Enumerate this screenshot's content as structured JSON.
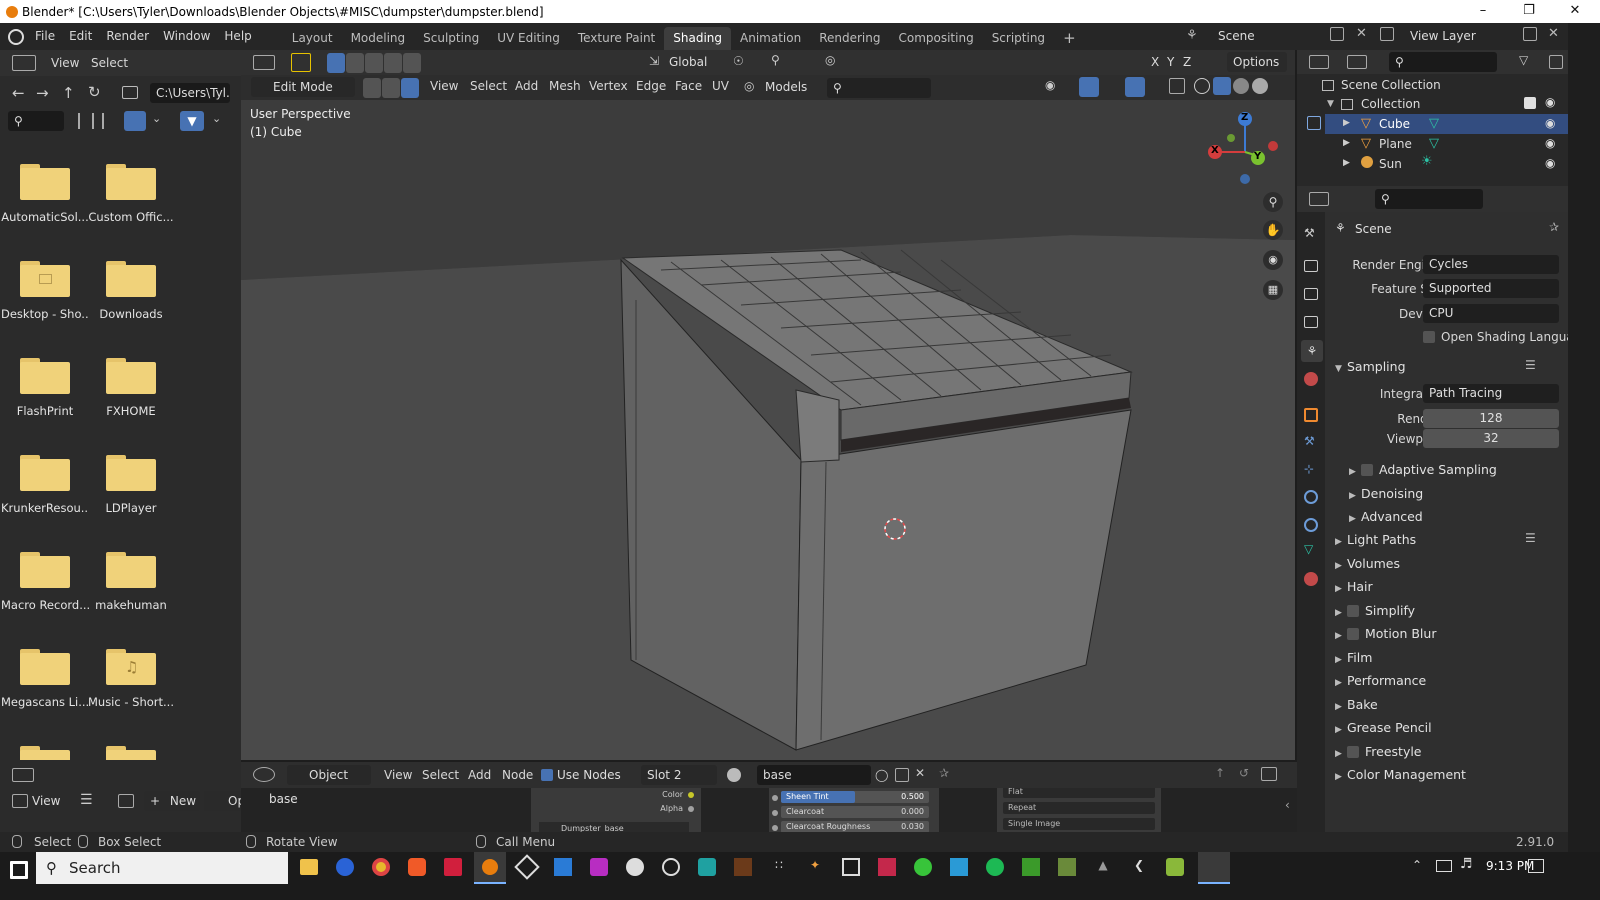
{
  "title_bar": {
    "title": "Blender* [C:\\Users\\Tyler\\Downloads\\Blender Objects\\#MISC\\dumpster\\dumpster.blend]"
  },
  "menu": {
    "items": [
      "File",
      "Edit",
      "Render",
      "Window",
      "Help"
    ]
  },
  "workspaces": {
    "tabs": [
      "Layout",
      "Modeling",
      "Sculpting",
      "UV Editing",
      "Texture Paint",
      "Shading",
      "Animation",
      "Rendering",
      "Compositing",
      "Scripting"
    ],
    "active": "Shading",
    "add": "+"
  },
  "scene_selector": {
    "scene": "Scene",
    "view_layer": "View Layer"
  },
  "file_browser": {
    "menu": [
      "View",
      "Select"
    ],
    "path": "C:\\Users\\Tyl...",
    "items": [
      {
        "name": "AutomaticSol...",
        "icon": "folder-icon"
      },
      {
        "name": "Custom Offic...",
        "icon": "folder-icon"
      },
      {
        "name": "Desktop - Sho...",
        "icon": "folder-shortcut-icon"
      },
      {
        "name": "Downloads",
        "icon": "folder-icon"
      },
      {
        "name": "FlashPrint",
        "icon": "folder-icon"
      },
      {
        "name": "FXHOME",
        "icon": "folder-icon"
      },
      {
        "name": "KrunkerResou...",
        "icon": "folder-icon"
      },
      {
        "name": "LDPlayer",
        "icon": "folder-icon"
      },
      {
        "name": "Macro Record...",
        "icon": "folder-icon"
      },
      {
        "name": "makehuman",
        "icon": "folder-icon"
      },
      {
        "name": "Megascans Li...",
        "icon": "folder-icon"
      },
      {
        "name": "Music - Short...",
        "icon": "music-folder-icon"
      }
    ]
  },
  "viewport": {
    "header": {
      "orientation": "Global",
      "options": "Options",
      "axes": [
        "X",
        "Y",
        "Z"
      ]
    },
    "header2": {
      "mode": "Edit Mode",
      "menus": [
        "View",
        "Select",
        "Add",
        "Mesh",
        "Vertex",
        "Edge",
        "Face",
        "UV"
      ],
      "collection": "Models"
    },
    "overlay_text": {
      "perspective": "User Perspective",
      "object": "(1) Cube"
    },
    "gizmo": {
      "x": "X",
      "y": "Y",
      "z": "Z"
    }
  },
  "outliner": {
    "root": "Scene Collection",
    "collection": "Collection",
    "items": [
      {
        "name": "Cube",
        "selected": true
      },
      {
        "name": "Plane",
        "selected": false
      },
      {
        "name": "Sun",
        "selected": false
      }
    ]
  },
  "properties": {
    "header": "Scene",
    "render_engine": {
      "label": "Render Engine",
      "value": "Cycles"
    },
    "feature_set": {
      "label": "Feature Set",
      "value": "Supported"
    },
    "device": {
      "label": "Device",
      "value": "CPU"
    },
    "open_shading_language": "Open Shading Language",
    "sampling": {
      "title": "Sampling",
      "integrator": {
        "label": "Integrator",
        "value": "Path Tracing"
      },
      "render": {
        "label": "Render",
        "value": "128"
      },
      "viewport": {
        "label": "Viewport",
        "value": "32"
      },
      "subsections": [
        "Adaptive Sampling",
        "Denoising",
        "Advanced"
      ]
    },
    "panels": [
      "Light Paths",
      "Volumes",
      "Hair",
      "Simplify",
      "Motion Blur",
      "Film",
      "Performance",
      "Bake",
      "Grease Pencil",
      "Freestyle",
      "Color Management"
    ]
  },
  "node_editor": {
    "object": "Object",
    "menus": [
      "View",
      "Select",
      "Add",
      "Node"
    ],
    "use_nodes": "Use Nodes",
    "slot": "Slot 2",
    "material": "base",
    "node_label": "base",
    "node_rows": [
      {
        "name": "Sheen Tint",
        "value": "0.500"
      },
      {
        "name": "Clearcoat",
        "value": "0.000"
      },
      {
        "name": "Clearcoat Roughness",
        "value": "0.030"
      }
    ],
    "socket_labels": [
      "Color",
      "Alpha"
    ],
    "image_options": [
      "Flat",
      "Repeat",
      "Single Image"
    ],
    "node_title": "Dumpster_base"
  },
  "left_bottom": {
    "view": "View",
    "new": "New",
    "open": "Op"
  },
  "status_bar": {
    "select": "Select",
    "box_select": "Box Select",
    "rotate_view": "Rotate View",
    "call_menu": "Call Menu",
    "version": "2.91.0"
  },
  "taskbar": {
    "search": "Search",
    "time": "9:13 PM"
  }
}
